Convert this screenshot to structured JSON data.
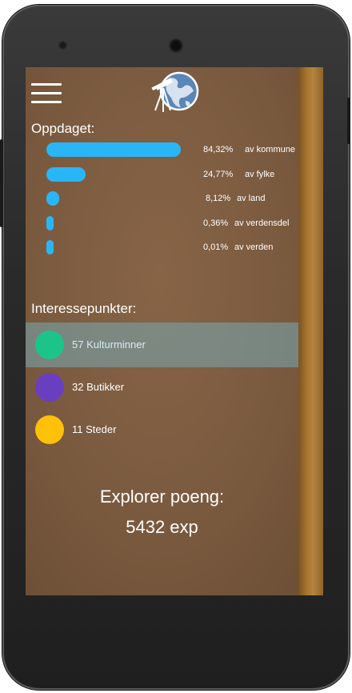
{
  "header": {
    "menu_icon": "hamburger-menu-icon",
    "logo_icon": "telescope-globe-logo-icon"
  },
  "discovered": {
    "title": "Oppdaget:",
    "rows": [
      {
        "percent": "84,32%",
        "label": "av kommune",
        "fraction": 0.8432
      },
      {
        "percent": "24,77%",
        "label": "av fylke",
        "fraction": 0.2477
      },
      {
        "percent": "8,12%",
        "label": "av land",
        "fraction": 0.0812
      },
      {
        "percent": "0,36%",
        "label": "av verdensdel",
        "fraction": 0.0036
      },
      {
        "percent": "0,01%",
        "label": "av verden",
        "fraction": 0.0001
      }
    ],
    "bar_color": "#29b6f6"
  },
  "poi": {
    "title": "Interessepunkter:",
    "items": [
      {
        "label": "57 Kulturminner",
        "color": "#1dc48a",
        "selected": true
      },
      {
        "label": "32 Butikker",
        "color": "#6a3fbf",
        "selected": false
      },
      {
        "label": "11 Steder",
        "color": "#ffc107",
        "selected": false
      }
    ]
  },
  "score": {
    "title": "Explorer poeng:",
    "value": "5432 exp"
  }
}
